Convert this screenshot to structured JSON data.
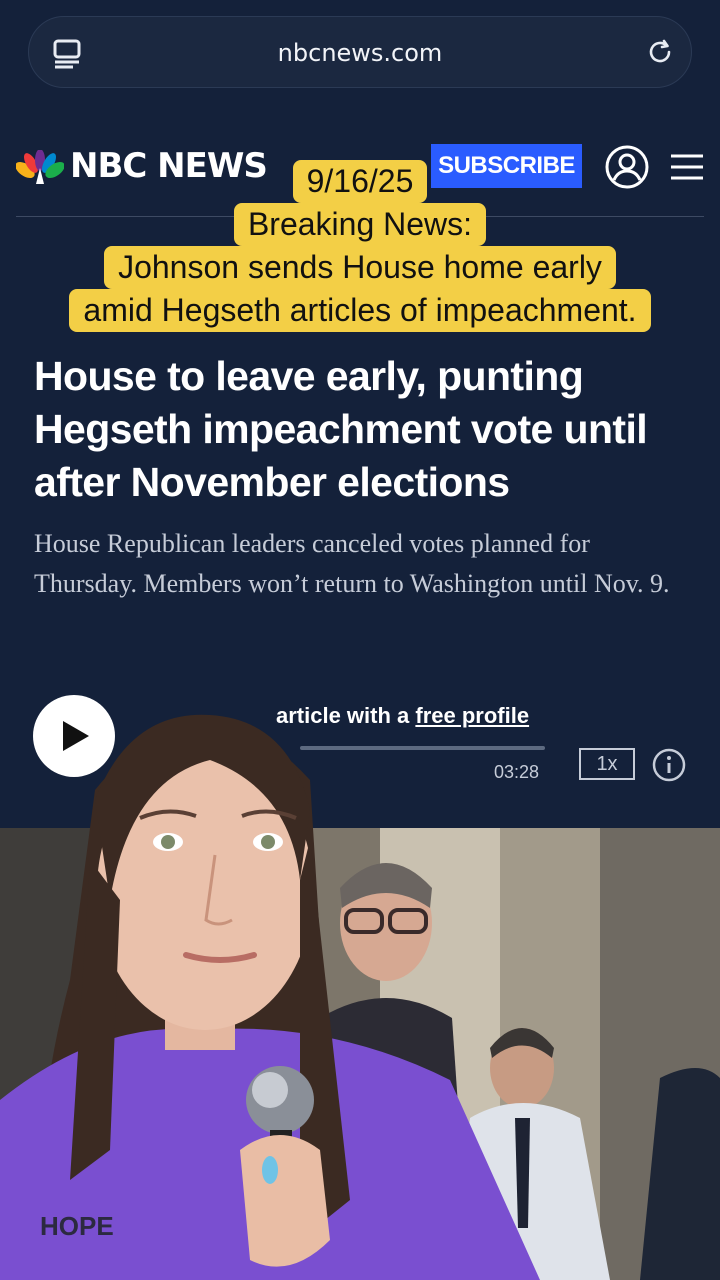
{
  "browser": {
    "url": "nbcnews.com",
    "tabs_icon": "tabs-icon",
    "reload_icon": "reload-icon"
  },
  "header": {
    "logo_text": "NBC NEWS",
    "subscribe_label": "SUBSCRIBE",
    "profile_icon": "profile-icon",
    "menu_icon": "hamburger-menu-icon"
  },
  "caption": {
    "date": "9/16/25",
    "label": "Breaking News:",
    "line1": "Johnson sends House home early",
    "line2": "amid Hegseth articles of impeachment."
  },
  "article": {
    "headline": "House to leave early, punting Hegseth impeachment vote until after November elections",
    "dek": "House Republican leaders canceled votes planned for Thursday. Members won’t return to Washington until Nov. 9."
  },
  "audio": {
    "listen_text": "article with a ",
    "free_profile_link": "free profile",
    "duration": "03:28",
    "speed": "1x",
    "progress": 0
  },
  "colors": {
    "page_bg": "#14213a",
    "subscribe_bg": "#2a5cff",
    "caption_bg": "#f3cf46",
    "shirt": "#7a4fd0"
  }
}
